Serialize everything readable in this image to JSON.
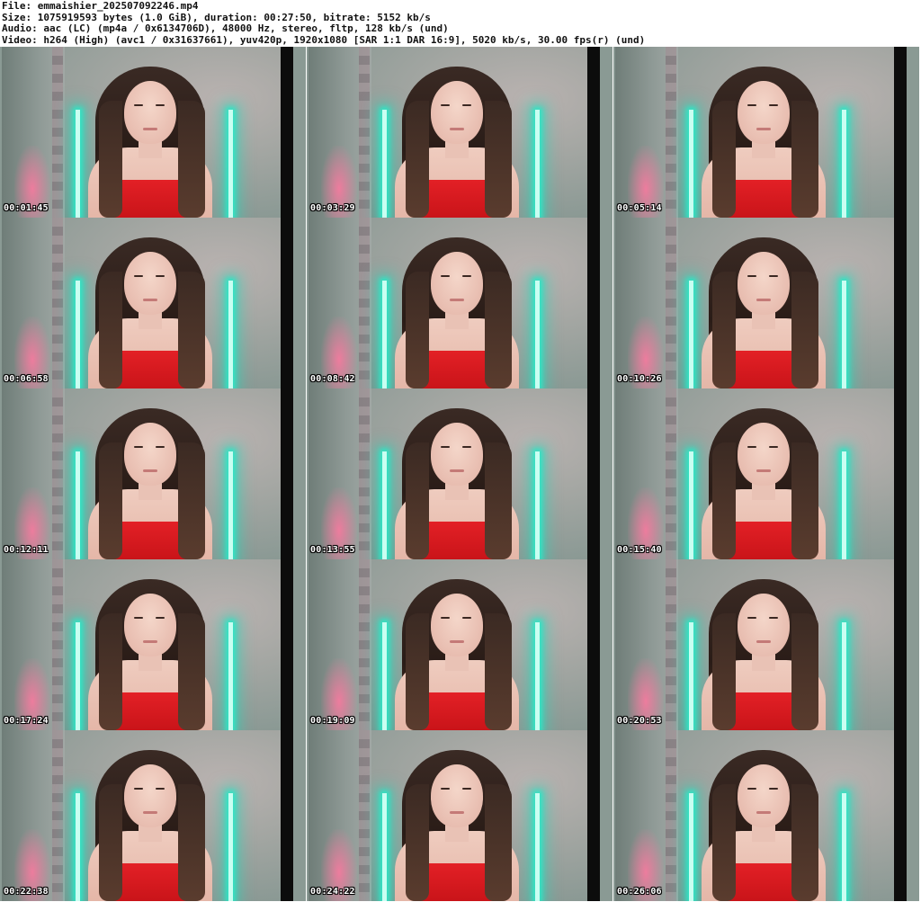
{
  "header": {
    "file_line": "File: emmaishier_202507092246.mp4",
    "size_line": "Size: 1075919593 bytes (1.0 GiB), duration: 00:27:50, bitrate: 5152 kb/s",
    "audio_line": "Audio: aac (LC) (mp4a / 0x6134706D), 48000 Hz, stereo, fltp, 128 kb/s (und)",
    "video_line": "Video: h264 (High) (avc1 / 0x31637661), yuv420p, 1920x1080 [SAR 1:1 DAR 16:9], 5020 kb/s, 30.00 fps(r) (und)"
  },
  "thumbnails": [
    {
      "timestamp": "00:01:45"
    },
    {
      "timestamp": "00:03:29"
    },
    {
      "timestamp": "00:05:14"
    },
    {
      "timestamp": "00:06:58"
    },
    {
      "timestamp": "00:08:42"
    },
    {
      "timestamp": "00:10:26"
    },
    {
      "timestamp": "00:12:11"
    },
    {
      "timestamp": "00:13:55"
    },
    {
      "timestamp": "00:15:40"
    },
    {
      "timestamp": "00:17:24"
    },
    {
      "timestamp": "00:19:09"
    },
    {
      "timestamp": "00:20:53"
    },
    {
      "timestamp": "00:22:38"
    },
    {
      "timestamp": "00:24:22"
    },
    {
      "timestamp": "00:26:06"
    }
  ],
  "colors": {
    "neon_accent": "#2fe6c6",
    "top_red": "#e32026",
    "wall_gray": "#8c9a95",
    "timestamp_text": "#ffffff"
  }
}
